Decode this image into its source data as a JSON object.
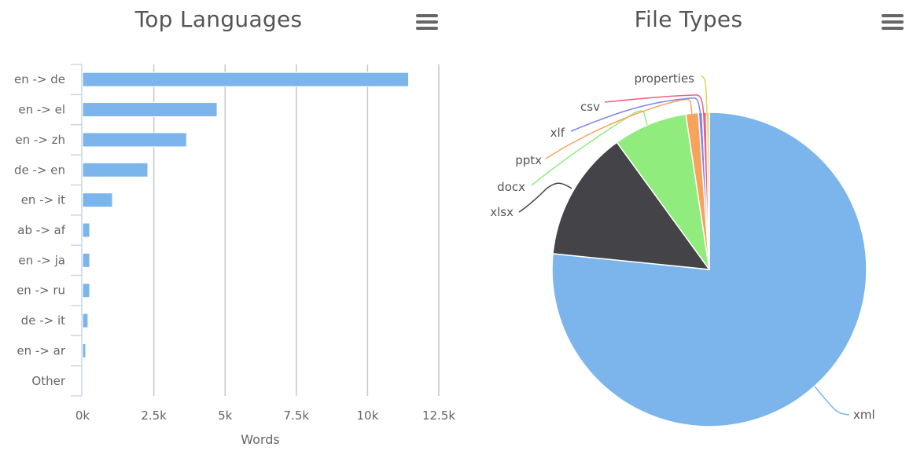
{
  "chart_data": [
    {
      "type": "bar",
      "orientation": "horizontal",
      "title": "Top Languages",
      "xlabel": "Words",
      "ylabel": "",
      "categories": [
        "en -> de",
        "en -> el",
        "en -> zh",
        "de -> en",
        "en -> it",
        "ab -> af",
        "en -> ja",
        "en -> ru",
        "de -> it",
        "en -> ar",
        "Other"
      ],
      "values": [
        11440,
        4720,
        3650,
        2290,
        1050,
        250,
        250,
        250,
        190,
        110,
        0
      ],
      "xlim": [
        0,
        12500
      ],
      "xticks": [
        0,
        2500,
        5000,
        7500,
        10000,
        12500
      ],
      "xtick_labels": [
        "0k",
        "2.5k",
        "5k",
        "7.5k",
        "10k",
        "12.5k"
      ],
      "grid": true,
      "color": "#7cb5ec"
    },
    {
      "type": "pie",
      "title": "File Types",
      "slices": [
        {
          "label": "xml",
          "value": 76.6,
          "color": "#7cb5ec"
        },
        {
          "label": "xlsx",
          "value": 13.4,
          "color": "#434348"
        },
        {
          "label": "docx",
          "value": 7.6,
          "color": "#90ed7d"
        },
        {
          "label": "pptx",
          "value": 1.3,
          "color": "#f7a35c"
        },
        {
          "label": "xlf",
          "value": 0.4,
          "color": "#8085e9"
        },
        {
          "label": "csv",
          "value": 0.4,
          "color": "#f15c80"
        },
        {
          "label": "properties",
          "value": 0.3,
          "color": "#e4d354"
        }
      ]
    }
  ],
  "ui": {
    "menu_icon": "hamburger-menu-icon"
  }
}
